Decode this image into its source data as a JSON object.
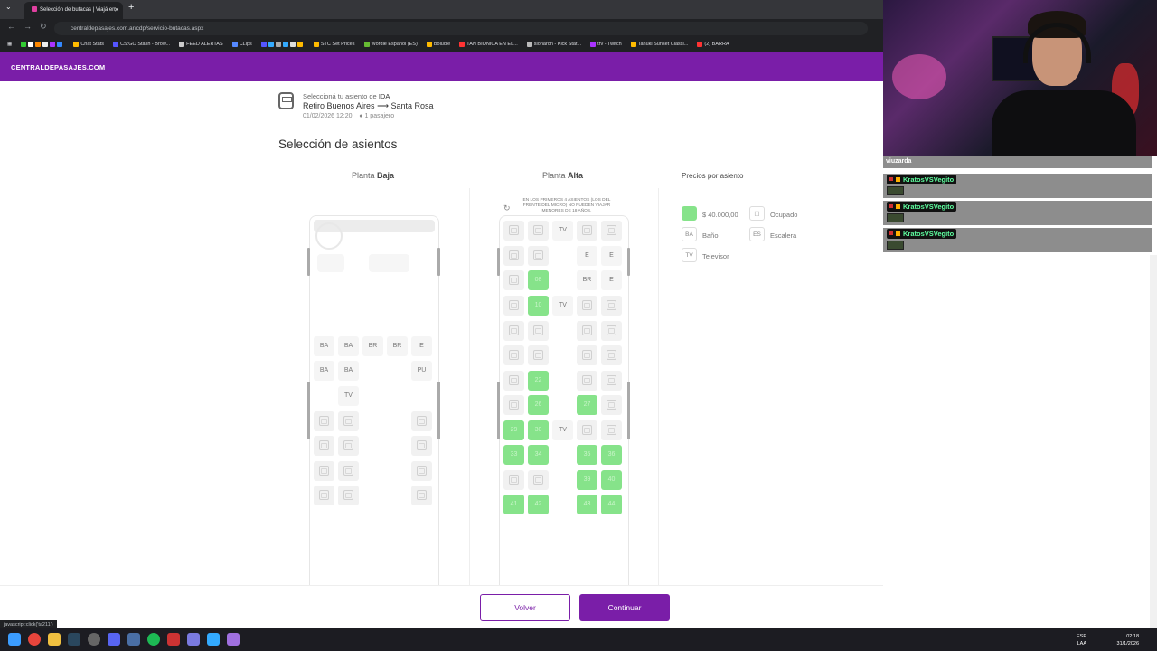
{
  "browser": {
    "tab_title": "Selección de butacas | Viajá en",
    "url": "centraldepasajes.com.ar/cdp/servicio-butacas.aspx",
    "status_url": "javascript:click('ta211')",
    "bookmarks": [
      "Chat Stats",
      "CS:GO Stash - Brow...",
      "FEED ALERTAS",
      "CLips",
      "STC Set Prices",
      "Wordle Español (ES)",
      "Boludle",
      "TAN BIONICA EN EL...",
      "sionaron - Kick Stat...",
      "trv - Twitch",
      "Tanuki Sunset Classi...",
      "(2) BARRA"
    ]
  },
  "site": {
    "logo": "CENTRALDEPASAJES.COM"
  },
  "trip": {
    "prefix": "Seleccioná tu asiento de ",
    "direction": "IDA",
    "origin": "Retiro Buenos Aires",
    "arrow": "⟶",
    "destination": "Santa Rosa",
    "date": "01/02/2026 12:20",
    "passengers": "1 pasajero"
  },
  "page_title": "Selección de asientos",
  "floors": {
    "lower": {
      "prefix": "Planta ",
      "name": "Baja"
    },
    "upper": {
      "prefix": "Planta ",
      "name": "Alta"
    }
  },
  "upper_warning": "EN LOS PRIMEROS 4 ASIENTOS (LOS DEL FRENTE DEL MICRO) NO PUEDEN VIAJAR MENORES DE 18 AÑOS.",
  "lower_facilities": [
    "BA",
    "BA",
    "BR",
    "BR",
    "E",
    "BA",
    "BA",
    "PU",
    "TV"
  ],
  "upper_facilities": [
    "TV",
    "E",
    "E",
    "BR",
    "E",
    "TV",
    "TV"
  ],
  "available_seats": [
    "08",
    "10",
    "22",
    "26",
    "27",
    "29",
    "30",
    "33",
    "34",
    "35",
    "36",
    "39",
    "40",
    "41",
    "42",
    "43",
    "44"
  ],
  "legend": {
    "title": "Precios por asiento",
    "price": "$ 40.000,00",
    "occupied": "Ocupado",
    "ba_code": "BA",
    "ba_label": "Baño",
    "es_code": "ES",
    "es_label": "Escalera",
    "tv_code": "TV",
    "tv_label": "Televisor"
  },
  "buttons": {
    "back": "Volver",
    "next": "Continuar"
  },
  "stream_chat": {
    "top_user": "viuzarda",
    "user": "KratosVSVegito"
  },
  "tray": {
    "lang": "ESP",
    "lang2": "LAA",
    "time": "02:18",
    "date": "31/1/2026"
  },
  "colors": {
    "brand": "#7a1ea8",
    "available_seat": "#86e38a"
  }
}
